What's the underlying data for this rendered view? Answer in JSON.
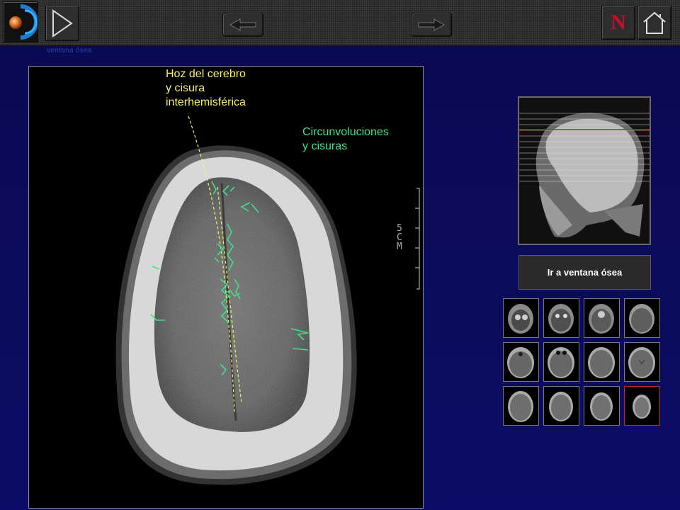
{
  "toolbar": {
    "buttons": [
      {
        "name": "logo-button",
        "icon": "orb-logo-icon"
      },
      {
        "name": "play-button",
        "icon": "play-triangle-icon"
      },
      {
        "name": "previous-button",
        "icon": "arrow-left-icon"
      },
      {
        "name": "next-button",
        "icon": "arrow-right-icon"
      },
      {
        "name": "north-button",
        "label": "N"
      },
      {
        "name": "home-button",
        "icon": "home-icon"
      }
    ],
    "subtitle": "ventana ósea"
  },
  "viewer": {
    "labels": {
      "hoz": "Hoz del cerebro\ny cisura\ninterhemisférica",
      "circunvoluciones": "Circunvoluciones\ny cisuras"
    },
    "scale_label": "5CM",
    "annotation_colors": {
      "hoz": "#f6f06a",
      "circunvoluciones": "#3fe08a"
    }
  },
  "scout": {
    "selected_line_color": "#d02020"
  },
  "bone_window_button": {
    "label": "Ir a ventana ósea"
  },
  "thumbnails": {
    "rows": 3,
    "cols": 4,
    "selected_index": 11,
    "selected_color": "#d0202a"
  }
}
